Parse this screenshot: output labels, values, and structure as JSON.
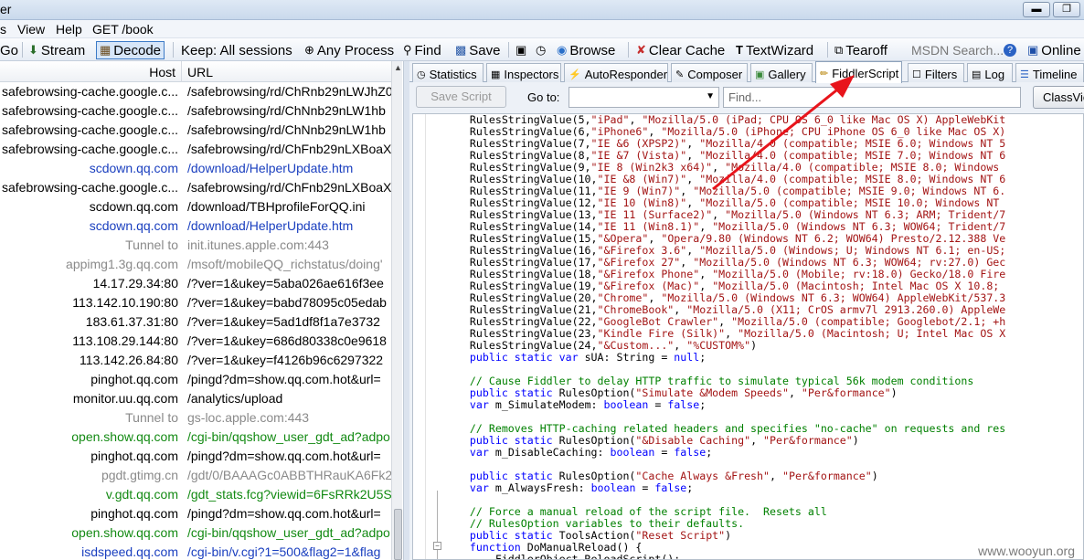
{
  "window": {
    "title_fragment": "er"
  },
  "menu": [
    "s",
    "View",
    "Help",
    "GET /book"
  ],
  "toolbar": {
    "go": "Go",
    "stream": "Stream",
    "decode": "Decode",
    "keep": "Keep: All sessions",
    "any_process": "Any Process",
    "find": "Find",
    "save": "Save",
    "browse": "Browse",
    "clear_cache": "Clear Cache",
    "textwizard": "TextWizard",
    "tearoff": "Tearoff",
    "msdn_search": "MSDN Search...",
    "online": "Online"
  },
  "sessions": {
    "headers": {
      "host": "Host",
      "url": "URL"
    },
    "rows": [
      {
        "host": "safebrowsing-cache.google.c...",
        "url": "/safebrowsing/rd/ChRnb29nLWJhZ0",
        "color": "dark"
      },
      {
        "host": "safebrowsing-cache.google.c...",
        "url": "/safebrowsing/rd/ChNnb29nLW1hb",
        "color": "dark"
      },
      {
        "host": "safebrowsing-cache.google.c...",
        "url": "/safebrowsing/rd/ChNnb29nLW1hb",
        "color": "dark"
      },
      {
        "host": "safebrowsing-cache.google.c...",
        "url": "/safebrowsing/rd/ChFnb29nLXBoaX",
        "color": "dark"
      },
      {
        "host": "scdown.qq.com",
        "url": "/download/HelperUpdate.htm",
        "color": "blue"
      },
      {
        "host": "safebrowsing-cache.google.c...",
        "url": "/safebrowsing/rd/ChFnb29nLXBoaX",
        "color": "dark"
      },
      {
        "host": "scdown.qq.com",
        "url": "/download/TBHprofileForQQ.ini",
        "color": "dark"
      },
      {
        "host": "scdown.qq.com",
        "url": "/download/HelperUpdate.htm",
        "color": "blue"
      },
      {
        "host": "Tunnel to",
        "url": "init.itunes.apple.com:443",
        "color": "gray"
      },
      {
        "host": "appimg1.3g.qq.com",
        "url": "/msoft/mobileQQ_richstatus/doing'",
        "color": "gray"
      },
      {
        "host": "14.17.29.34:80",
        "url": "/?ver=1&ukey=5aba026ae616f3ee",
        "color": "dark"
      },
      {
        "host": "113.142.10.190:80",
        "url": "/?ver=1&ukey=babd78095c05edab",
        "color": "dark"
      },
      {
        "host": "183.61.37.31:80",
        "url": "/?ver=1&ukey=5ad1df8f1a7e3732",
        "color": "dark"
      },
      {
        "host": "113.108.29.144:80",
        "url": "/?ver=1&ukey=686d80338c0e9618",
        "color": "dark"
      },
      {
        "host": "113.142.26.84:80",
        "url": "/?ver=1&ukey=f4126b96c6297322",
        "color": "dark"
      },
      {
        "host": "pinghot.qq.com",
        "url": "/pingd?dm=show.qq.com.hot&url=",
        "color": "dark"
      },
      {
        "host": "monitor.uu.qq.com",
        "url": "/analytics/upload",
        "color": "dark"
      },
      {
        "host": "Tunnel to",
        "url": "gs-loc.apple.com:443",
        "color": "gray"
      },
      {
        "host": "open.show.qq.com",
        "url": "/cgi-bin/qqshow_user_gdt_ad?adpo",
        "color": "green"
      },
      {
        "host": "pinghot.qq.com",
        "url": "/pingd?dm=show.qq.com.hot&url=",
        "color": "dark"
      },
      {
        "host": "pgdt.gtimg.cn",
        "url": "/gdt/0/BAAAGc0ABBTHRauKA6Fk2",
        "color": "gray"
      },
      {
        "host": "v.gdt.qq.com",
        "url": "/gdt_stats.fcg?viewid=6FsRRk2U5S_",
        "color": "green"
      },
      {
        "host": "pinghot.qq.com",
        "url": "/pingd?dm=show.qq.com.hot&url=",
        "color": "dark"
      },
      {
        "host": "open.show.qq.com",
        "url": "/cgi-bin/qqshow_user_gdt_ad?adpo",
        "color": "green"
      },
      {
        "host": "isdspeed.qq.com",
        "url": "/cgi-bin/v.cgi?1=500&flag2=1&flag",
        "color": "blue"
      }
    ]
  },
  "tabs": [
    {
      "label": "Statistics",
      "icon": "stopwatch-icon"
    },
    {
      "label": "Inspectors",
      "icon": "inspect-icon"
    },
    {
      "label": "AutoResponder",
      "icon": "lightning-icon"
    },
    {
      "label": "Composer",
      "icon": "pencil-icon"
    },
    {
      "label": "Gallery",
      "icon": "image-icon"
    },
    {
      "label": "FiddlerScript",
      "icon": "script-icon",
      "active": true
    },
    {
      "label": "Filters",
      "icon": "checkbox-icon"
    },
    {
      "label": "Log",
      "icon": "log-icon"
    },
    {
      "label": "Timeline",
      "icon": "timeline-icon"
    }
  ],
  "script_bar": {
    "save_script": "Save Script",
    "goto_label": "Go to:",
    "goto_value": "",
    "find_placeholder": "Find...",
    "classview": "ClassView"
  },
  "code_lines": [
    [
      [
        "pl",
        "    RulesStringValue(5,"
      ],
      [
        "str",
        "\"iPad\""
      ],
      [
        "pl",
        ", "
      ],
      [
        "str",
        "\"Mozilla/5.0 (iPad; CPU OS 6_0 like Mac OS X) AppleWebKit"
      ]
    ],
    [
      [
        "pl",
        "    RulesStringValue(6,"
      ],
      [
        "str",
        "\"iPhone6\""
      ],
      [
        "pl",
        ", "
      ],
      [
        "str",
        "\"Mozilla/5.0 (iPhone; CPU iPhone OS 6_0 like Mac OS X)"
      ]
    ],
    [
      [
        "pl",
        "    RulesStringValue(7,"
      ],
      [
        "str",
        "\"IE &6 (XPSP2)\""
      ],
      [
        "pl",
        ", "
      ],
      [
        "str",
        "\"Mozilla/4.0 (compatible; MSIE 6.0; Windows NT 5"
      ]
    ],
    [
      [
        "pl",
        "    RulesStringValue(8,"
      ],
      [
        "str",
        "\"IE &7 (Vista)\""
      ],
      [
        "pl",
        ", "
      ],
      [
        "str",
        "\"Mozilla/4.0 (compatible; MSIE 7.0; Windows NT 6"
      ]
    ],
    [
      [
        "pl",
        "    RulesStringValue(9,"
      ],
      [
        "str",
        "\"IE 8 (Win2k3 x64)\""
      ],
      [
        "pl",
        ", "
      ],
      [
        "str",
        "\"Mozilla/4.0 (compatible; MSIE 8.0; Windows"
      ]
    ],
    [
      [
        "pl",
        "    RulesStringValue(10,"
      ],
      [
        "str",
        "\"IE &8 (Win7)\""
      ],
      [
        "pl",
        ", "
      ],
      [
        "str",
        "\"Mozilla/4.0 (compatible; MSIE 8.0; Windows NT 6"
      ]
    ],
    [
      [
        "pl",
        "    RulesStringValue(11,"
      ],
      [
        "str",
        "\"IE 9 (Win7)\""
      ],
      [
        "pl",
        ", "
      ],
      [
        "str",
        "\"Mozilla/5.0 (compatible; MSIE 9.0; Windows NT 6."
      ]
    ],
    [
      [
        "pl",
        "    RulesStringValue(12,"
      ],
      [
        "str",
        "\"IE 10 (Win8)\""
      ],
      [
        "pl",
        ", "
      ],
      [
        "str",
        "\"Mozilla/5.0 (compatible; MSIE 10.0; Windows NT"
      ]
    ],
    [
      [
        "pl",
        "    RulesStringValue(13,"
      ],
      [
        "str",
        "\"IE 11 (Surface2)\""
      ],
      [
        "pl",
        ", "
      ],
      [
        "str",
        "\"Mozilla/5.0 (Windows NT 6.3; ARM; Trident/7"
      ]
    ],
    [
      [
        "pl",
        "    RulesStringValue(14,"
      ],
      [
        "str",
        "\"IE 11 (Win8.1)\""
      ],
      [
        "pl",
        ", "
      ],
      [
        "str",
        "\"Mozilla/5.0 (Windows NT 6.3; WOW64; Trident/7"
      ]
    ],
    [
      [
        "pl",
        "    RulesStringValue(15,"
      ],
      [
        "str",
        "\"&Opera\""
      ],
      [
        "pl",
        ", "
      ],
      [
        "str",
        "\"Opera/9.80 (Windows NT 6.2; WOW64) Presto/2.12.388 Ve"
      ]
    ],
    [
      [
        "pl",
        "    RulesStringValue(16,"
      ],
      [
        "str",
        "\"&Firefox 3.6\""
      ],
      [
        "pl",
        ", "
      ],
      [
        "str",
        "\"Mozilla/5.0 (Windows; U; Windows NT 6.1; en-US;"
      ]
    ],
    [
      [
        "pl",
        "    RulesStringValue(17,"
      ],
      [
        "str",
        "\"&Firefox 27\""
      ],
      [
        "pl",
        ", "
      ],
      [
        "str",
        "\"Mozilla/5.0 (Windows NT 6.3; WOW64; rv:27.0) Gec"
      ]
    ],
    [
      [
        "pl",
        "    RulesStringValue(18,"
      ],
      [
        "str",
        "\"&Firefox Phone\""
      ],
      [
        "pl",
        ", "
      ],
      [
        "str",
        "\"Mozilla/5.0 (Mobile; rv:18.0) Gecko/18.0 Fire"
      ]
    ],
    [
      [
        "pl",
        "    RulesStringValue(19,"
      ],
      [
        "str",
        "\"&Firefox (Mac)\""
      ],
      [
        "pl",
        ", "
      ],
      [
        "str",
        "\"Mozilla/5.0 (Macintosh; Intel Mac OS X 10.8;"
      ]
    ],
    [
      [
        "pl",
        "    RulesStringValue(20,"
      ],
      [
        "str",
        "\"Chrome\""
      ],
      [
        "pl",
        ", "
      ],
      [
        "str",
        "\"Mozilla/5.0 (Windows NT 6.3; WOW64) AppleWebKit/537.3"
      ]
    ],
    [
      [
        "pl",
        "    RulesStringValue(21,"
      ],
      [
        "str",
        "\"ChromeBook\""
      ],
      [
        "pl",
        ", "
      ],
      [
        "str",
        "\"Mozilla/5.0 (X11; CrOS armv7l 2913.260.0) AppleWe"
      ]
    ],
    [
      [
        "pl",
        "    RulesStringValue(22,"
      ],
      [
        "str",
        "\"GoogleBot Crawler\""
      ],
      [
        "pl",
        ", "
      ],
      [
        "str",
        "\"Mozilla/5.0 (compatible; Googlebot/2.1; +h"
      ]
    ],
    [
      [
        "pl",
        "    RulesStringValue(23,"
      ],
      [
        "str",
        "\"Kindle Fire (Silk)\""
      ],
      [
        "pl",
        ", "
      ],
      [
        "str",
        "\"Mozilla/5.0 (Macintosh; U; Intel Mac OS X"
      ]
    ],
    [
      [
        "pl",
        "    RulesStringValue(24,"
      ],
      [
        "str",
        "\"&Custom...\""
      ],
      [
        "pl",
        ", "
      ],
      [
        "str",
        "\"%CUSTOM%\""
      ],
      [
        "pl",
        ")"
      ]
    ],
    [
      [
        "kw",
        "    public static var"
      ],
      [
        "pl",
        " sUA: String = "
      ],
      [
        "kw",
        "null"
      ],
      [
        "pl",
        ";"
      ]
    ],
    [
      [
        "pl",
        ""
      ]
    ],
    [
      [
        "cm",
        "    // Cause Fiddler to delay HTTP traffic to simulate typical 56k modem conditions"
      ]
    ],
    [
      [
        "kw",
        "    public static"
      ],
      [
        "pl",
        " RulesOption("
      ],
      [
        "str",
        "\"Simulate &Modem Speeds\""
      ],
      [
        "pl",
        ", "
      ],
      [
        "str",
        "\"Per&formance\""
      ],
      [
        "pl",
        ")"
      ]
    ],
    [
      [
        "kw",
        "    var"
      ],
      [
        "pl",
        " m_SimulateModem: "
      ],
      [
        "kw",
        "boolean"
      ],
      [
        "pl",
        " = "
      ],
      [
        "kw",
        "false"
      ],
      [
        "pl",
        ";"
      ]
    ],
    [
      [
        "pl",
        ""
      ]
    ],
    [
      [
        "cm",
        "    // Removes HTTP-caching related headers and specifies \"no-cache\" on requests and res"
      ]
    ],
    [
      [
        "kw",
        "    public static"
      ],
      [
        "pl",
        " RulesOption("
      ],
      [
        "str",
        "\"&Disable Caching\""
      ],
      [
        "pl",
        ", "
      ],
      [
        "str",
        "\"Per&formance\""
      ],
      [
        "pl",
        ")"
      ]
    ],
    [
      [
        "kw",
        "    var"
      ],
      [
        "pl",
        " m_DisableCaching: "
      ],
      [
        "kw",
        "boolean"
      ],
      [
        "pl",
        " = "
      ],
      [
        "kw",
        "false"
      ],
      [
        "pl",
        ";"
      ]
    ],
    [
      [
        "pl",
        ""
      ]
    ],
    [
      [
        "kw",
        "    public static"
      ],
      [
        "pl",
        " RulesOption("
      ],
      [
        "str",
        "\"Cache Always &Fresh\""
      ],
      [
        "pl",
        ", "
      ],
      [
        "str",
        "\"Per&formance\""
      ],
      [
        "pl",
        ")"
      ]
    ],
    [
      [
        "kw",
        "    var"
      ],
      [
        "pl",
        " m_AlwaysFresh: "
      ],
      [
        "kw",
        "boolean"
      ],
      [
        "pl",
        " = "
      ],
      [
        "kw",
        "false"
      ],
      [
        "pl",
        ";"
      ]
    ],
    [
      [
        "pl",
        ""
      ]
    ],
    [
      [
        "cm",
        "    // Force a manual reload of the script file.  Resets all"
      ]
    ],
    [
      [
        "cm",
        "    // RulesOption variables to their defaults."
      ]
    ],
    [
      [
        "kw",
        "    public static"
      ],
      [
        "pl",
        " ToolsAction("
      ],
      [
        "str",
        "\"Reset Script\""
      ],
      [
        "pl",
        ")"
      ]
    ],
    [
      [
        "kw",
        "    function"
      ],
      [
        "pl",
        " DoManualReload() {"
      ]
    ],
    [
      [
        "pl",
        "        FiddlerObject.ReloadScript();"
      ]
    ]
  ],
  "watermark": "www.wooyun.org",
  "colors": {
    "annotation_arrow": "#e8141b",
    "keyword": "#0000ff",
    "string": "#a31515",
    "comment": "#008000"
  }
}
